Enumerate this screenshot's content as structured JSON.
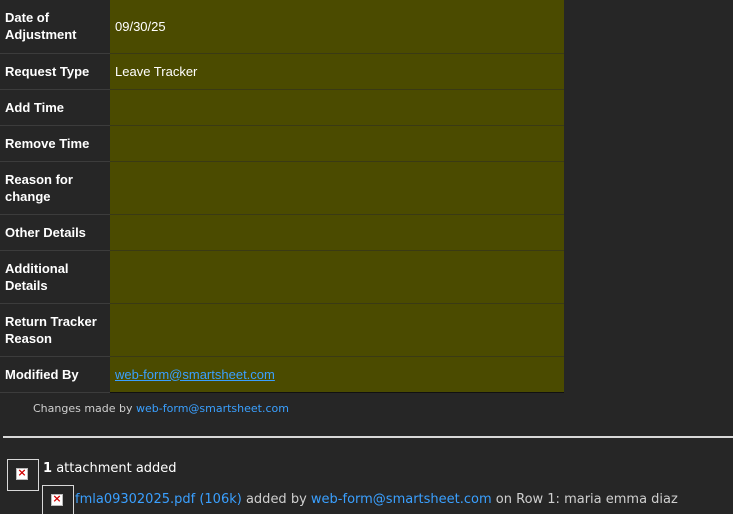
{
  "fields": [
    {
      "label": "Date of Adjustment",
      "value": "09/30/25"
    },
    {
      "label": "Request Type",
      "value": "Leave Tracker"
    },
    {
      "label": "Add Time",
      "value": ""
    },
    {
      "label": "Remove Time",
      "value": ""
    },
    {
      "label": "Reason for change",
      "value": ""
    },
    {
      "label": "Other Details",
      "value": ""
    },
    {
      "label": "Additional Details",
      "value": ""
    },
    {
      "label": "Return Tracker Reason",
      "value": ""
    },
    {
      "label": "Modified By",
      "value": "web-form@smartsheet.com"
    }
  ],
  "changes": {
    "prefix": "Changes made by",
    "author": "web-form@smartsheet.com"
  },
  "attachments": {
    "count": "1",
    "summary_text": "attachment added",
    "file_link": "fmla09302025.pdf (106k)",
    "added_by_text": "added by",
    "added_by": "web-form@smartsheet.com",
    "row_text": "on Row 1: maria emma diaz"
  },
  "colors": {
    "background": "#262626",
    "value_cell": "#4b4b00",
    "link": "#3aa0ff"
  },
  "icons": [
    "broken-image-icon"
  ]
}
